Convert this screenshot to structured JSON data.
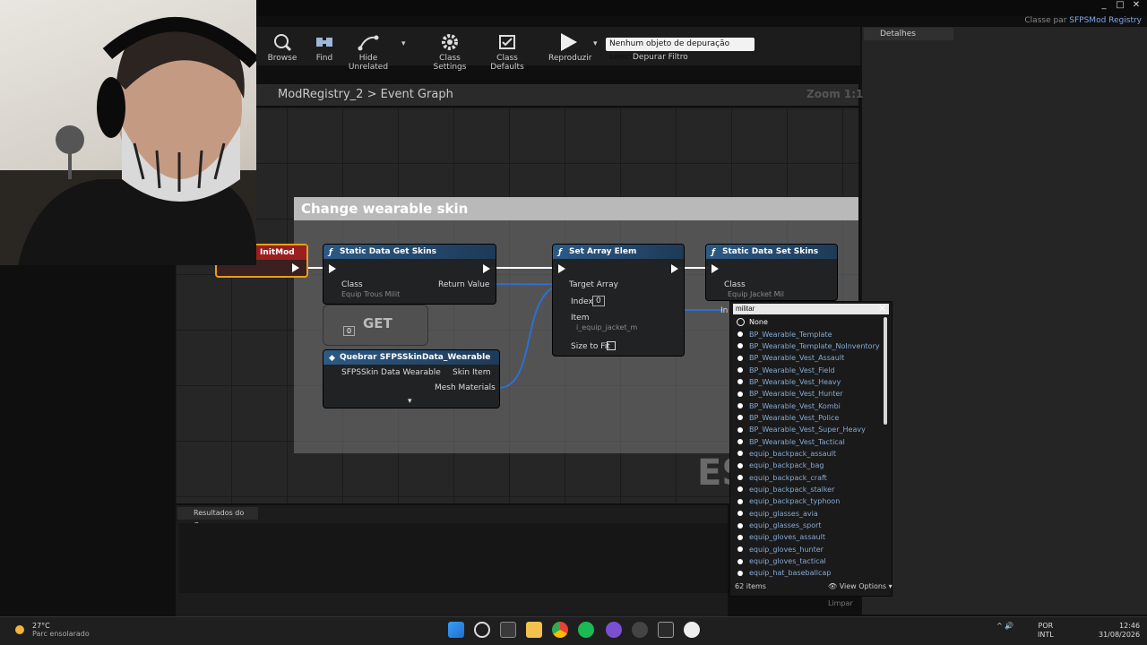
{
  "window": {
    "controls": [
      "_",
      "□",
      "✕"
    ]
  },
  "parent_class": {
    "label": "Classe par",
    "value": "SFPSMod Registry"
  },
  "toolbar": {
    "browse": "Browse",
    "find": "Find",
    "hide_unrelated": "Hide Unrelated",
    "class_settings": "Class Settings",
    "class_defaults": "Class Defaults",
    "play": "Reproduzir",
    "debug_object": "Nenhum objeto de depuração selecionado",
    "debug_filter": "Depurar Filtro"
  },
  "details_tab": "Detalhes",
  "graph": {
    "breadcrumb_root": "ModRegistry_2",
    "breadcrumb_separator": ">",
    "breadcrumb_page": "Event Graph",
    "zoom": "Zoom 1:1",
    "comment_title": "Change wearable skin",
    "watermark": "ES"
  },
  "nodes": {
    "init_mod": {
      "title": "InitMod"
    },
    "get_skins": {
      "title": "Static Data Get Skins",
      "class_label": "Class",
      "class_value": "Equip Trous Milit",
      "return_label": "Return Value"
    },
    "get": {
      "title": "GET",
      "index": "0"
    },
    "break": {
      "title": "Quebrar SFPSSkinData_Wearable",
      "input_label": "SFPSSkin Data Wearable",
      "skin_item": "Skin Item",
      "mesh_materials": "Mesh Materials"
    },
    "set_array": {
      "title": "Set Array Elem",
      "target_array": "Target Array",
      "index_label": "Index",
      "index_value": "0",
      "item_label": "Item",
      "item_value": "i_equip_jacket_m",
      "size_to_fit": "Size to Fit"
    },
    "set_skins": {
      "title": "Static Data Set Skins",
      "class_label": "Class",
      "class_value": "Equip Jacket Mil",
      "in_label": "In"
    }
  },
  "picker": {
    "search_value": "militar",
    "items": [
      "None",
      "BP_Wearable_Template",
      "BP_Wearable_Template_NoInventory",
      "BP_Wearable_Vest_Assault",
      "BP_Wearable_Vest_Field",
      "BP_Wearable_Vest_Heavy",
      "BP_Wearable_Vest_Hunter",
      "BP_Wearable_Vest_Kombi",
      "BP_Wearable_Vest_Police",
      "BP_Wearable_Vest_Super_Heavy",
      "BP_Wearable_Vest_Tactical",
      "equip_backpack_assault",
      "equip_backpack_bag",
      "equip_backpack_craft",
      "equip_backpack_stalker",
      "equip_backpack_typhoon",
      "equip_glasses_avia",
      "equip_glasses_sport",
      "equip_gloves_assault",
      "equip_gloves_hunter",
      "equip_gloves_tactical",
      "equip_hat_baseballcap"
    ],
    "item_count": "62 items",
    "view_options": "View Options",
    "clear": "Limpar"
  },
  "results_tab": "Resultados do Cor",
  "taskbar": {
    "temperature": "27°C",
    "weather": "Parc ensolarado",
    "lang_1": "POR",
    "lang_2": "INTL",
    "time": "12:46",
    "date": "31/08/2026"
  }
}
